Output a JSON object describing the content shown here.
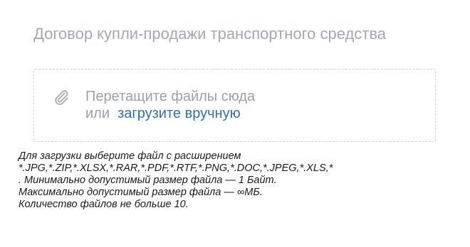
{
  "document": {
    "title": "Договор купли-продажи транспортного средства"
  },
  "dropzone": {
    "drag_text": "Перетащите файлы сюда",
    "or_text": "или",
    "upload_link": "загрузите вручную",
    "icon": "paperclip-icon"
  },
  "hint": {
    "lines": [
      "Для загрузки выберите файл с расширением",
      "*.JPG,*.ZIP,*.XLSX,*.RAR,*.PDF,*.RTF,*.PNG,*.DOC,*.JPEG,*.XLS,*",
      ". Минимально допустимый размер файла — 1 Байт.",
      "Максимально допустимый размер файла — ∞МБ.",
      "Количество файлов не больше 10."
    ]
  },
  "colors": {
    "title": "#a3a9b1",
    "link": "#2f6fb3",
    "muted_text": "#9aa1aa",
    "border": "#cfd3d8",
    "hint_text": "#1a1a1a"
  }
}
